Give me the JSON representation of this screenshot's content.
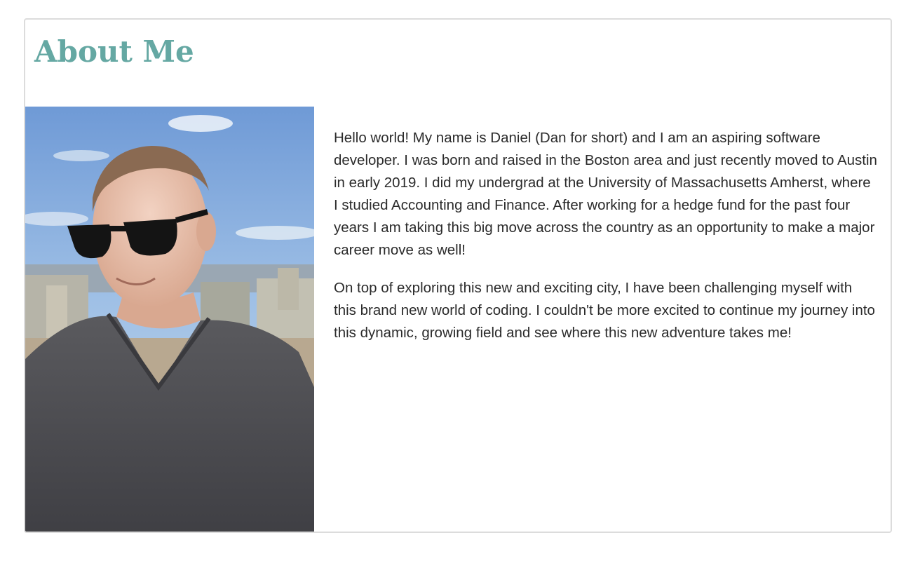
{
  "section": {
    "title": "About Me",
    "title_color": "#65a8a3"
  },
  "photo": {
    "description_icon": "portrait-photo"
  },
  "bio": {
    "paragraphs": [
      "Hello world! My name is Daniel (Dan for short) and I am an aspiring software developer. I was born and raised in the Boston area and just recently moved to Austin in early 2019. I did my undergrad at the University of Massachusetts Amherst, where I studied Accounting and Finance. After working for a hedge fund for the past four years I am taking this big move across the country as an opportunity to make a major career move as well!",
      "On top of exploring this new and exciting city, I have been challenging myself with this brand new world of coding. I couldn't be more excited to continue my journey into this dynamic, growing field and see where this new adventure takes me!"
    ]
  }
}
